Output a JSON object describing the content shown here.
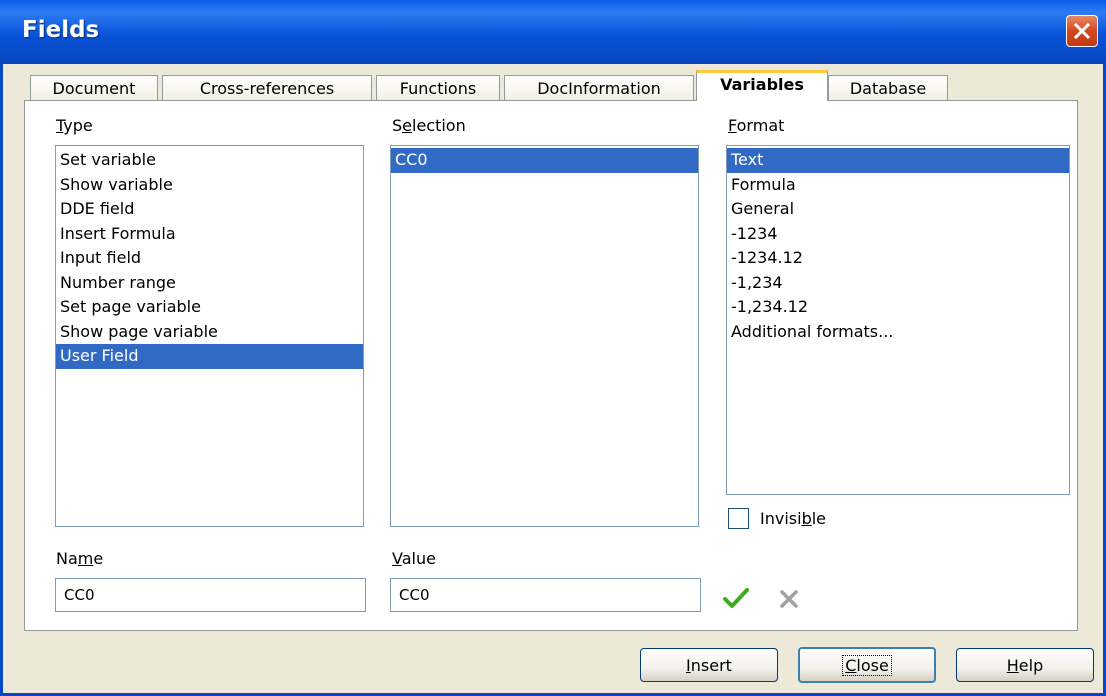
{
  "window": {
    "title": "Fields"
  },
  "tabs": [
    {
      "label": "Document"
    },
    {
      "label": "Cross-references"
    },
    {
      "label": "Functions"
    },
    {
      "label": "DocInformation"
    },
    {
      "label": "Variables"
    },
    {
      "label": "Database"
    }
  ],
  "active_tab": "Variables",
  "type": {
    "label": "Type",
    "items": [
      "Set variable",
      "Show variable",
      "DDE field",
      "Insert Formula",
      "Input field",
      "Number range",
      "Set page variable",
      "Show page variable",
      "User Field"
    ],
    "selected": "User Field"
  },
  "selection": {
    "label": "Selection",
    "items": [
      "CC0"
    ],
    "selected": "CC0"
  },
  "format": {
    "label": "Format",
    "items": [
      "Text",
      "Formula",
      "General",
      "-1234",
      "-1234.12",
      "-1,234",
      "-1,234.12",
      "Additional formats..."
    ],
    "selected": "Text"
  },
  "invisible": {
    "label": "Invisible",
    "checked": false
  },
  "name": {
    "label": "Name",
    "value": "CC0"
  },
  "value": {
    "label": "Value",
    "value": "CC0"
  },
  "buttons": {
    "insert": "Insert",
    "close": "Close",
    "help": "Help"
  },
  "colors": {
    "selection": "#316AC5",
    "titlebar": "#0A5FE8",
    "apply": "#3DAA1F",
    "discard": "#A0A0A0"
  },
  "icons": {
    "apply": "checkmark-icon",
    "discard": "x-icon",
    "close": "close-icon"
  }
}
